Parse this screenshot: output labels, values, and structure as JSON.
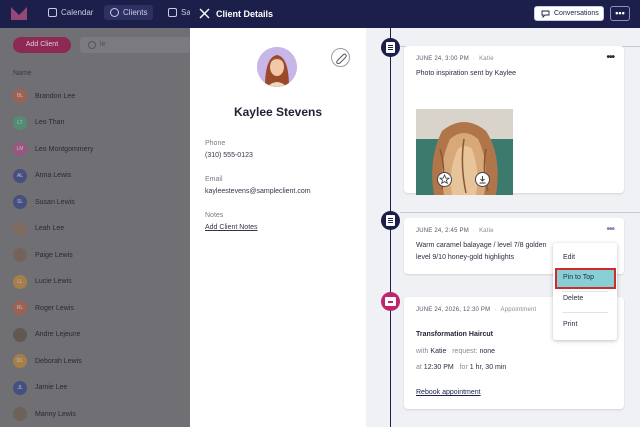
{
  "background_app": {
    "nav": {
      "calendar": "Calendar",
      "clients": "Clients",
      "sales_partial": "Sal"
    },
    "add_client": "Add Client",
    "search_value": "le",
    "column_name": "Name",
    "clients": [
      {
        "name": "Brandon Lee",
        "initials": "BL",
        "color": "#c0583b"
      },
      {
        "name": "Leo Than",
        "initials": "LT",
        "color": "#3fa071"
      },
      {
        "name": "Leo Montgommery",
        "initials": "LM",
        "color": "#b8468a"
      },
      {
        "name": "Anna Lewis",
        "initials": "AL",
        "color": "#2d3a8a"
      },
      {
        "name": "Susan Lewis",
        "initials": "SL",
        "color": "#2d3a8a"
      },
      {
        "name": "Leah Lee",
        "initials": "",
        "color": "#8a6a55"
      },
      {
        "name": "Paige Lewis",
        "initials": "",
        "color": "#7a5a4a"
      },
      {
        "name": "Lucie Lewis",
        "initials": "LL",
        "color": "#c98a2e"
      },
      {
        "name": "Roger Lewis",
        "initials": "RL",
        "color": "#c0583b"
      },
      {
        "name": "Andre Lejeune",
        "initials": "",
        "color": "#5a4a3a"
      },
      {
        "name": "Deborah Lewis",
        "initials": "DL",
        "color": "#c98a2e"
      },
      {
        "name": "Jamie Lee",
        "initials": "JL",
        "color": "#2d3a8a"
      },
      {
        "name": "Manny Lewis",
        "initials": "",
        "color": "#6a5a4a"
      }
    ]
  },
  "modal": {
    "title": "Client Details",
    "conversations": "Conversations",
    "more": "•••"
  },
  "client": {
    "name": "Kaylee Stevens",
    "phone_label": "Phone",
    "phone": "(310) 555-0123",
    "email_label": "Email",
    "email": "kayleestevens@sampleclient.com",
    "notes_label": "Notes",
    "add_notes": "Add Client Notes"
  },
  "timeline": {
    "entry1": {
      "date": "JUNE 24, 3:00 PM",
      "author": "Katie",
      "text": "Photo inspiration sent by Kaylee"
    },
    "entry2": {
      "date": "JUNE 24, 2:45 PM",
      "author": "Katie",
      "line1": "Warm caramel balayage /  level 7/8 golden",
      "line2": "level 9/10 honey-gold highlights"
    },
    "entry3": {
      "date": "JUNE 24, 2026, 12:30 PM",
      "type": "Appointment",
      "title": "Transformation Haircut",
      "with_label": "with",
      "with_value": "Katie",
      "request_label": "request:",
      "request_value": "none",
      "at_label": "at",
      "at_value": "12:30 PM",
      "for_label": "for",
      "for_value": "1 hr, 30 min",
      "rebook": "Rebook appointment"
    }
  },
  "context_menu": {
    "edit": "Edit",
    "pin": "Pin to Top",
    "delete": "Delete",
    "print": "Print"
  },
  "colors": {
    "navy": "#1b1f4a",
    "magenta": "#c0246f",
    "highlight": "#87cfd5",
    "highlight_border": "#d12a2a"
  }
}
